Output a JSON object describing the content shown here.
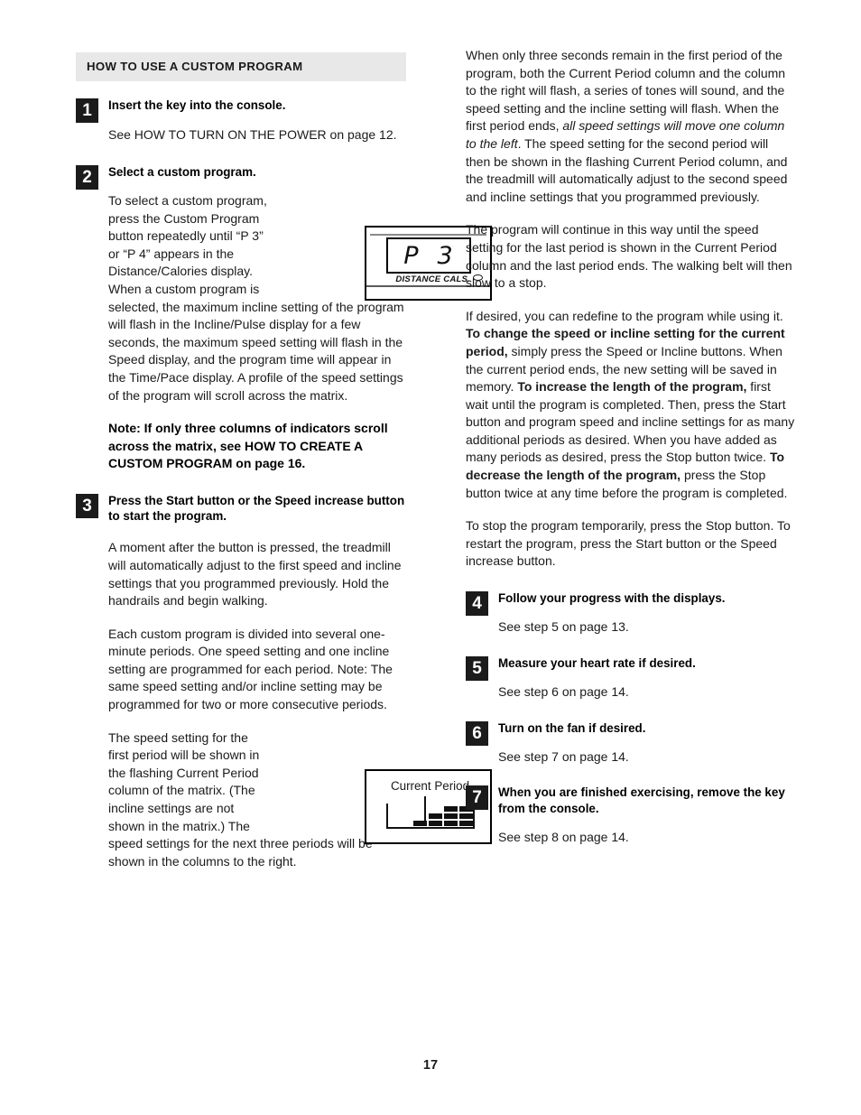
{
  "page": {
    "number": "17"
  },
  "left_column": {
    "section_heading": "HOW TO USE A CUSTOM PROGRAM",
    "steps": [
      {
        "number": "1",
        "title": "Insert the key into the console.",
        "body": "See HOW TO TURN ON THE POWER on page 12."
      },
      {
        "number": "2",
        "title": "Select a custom program.",
        "body_wrapped": "To select a custom program, press the Custom Program button repeatedly until “P 3” or “P 4” appears in the Distance/Calories display. When a custom program is selected, the maximum incline setting of the program will flash in the Incline/Pulse display for a few seconds, the maximum speed setting will flash in the Speed display, and the program time will appear in the Time/Pace display. A profile of the speed settings of the program will scroll across the matrix.",
        "note": "Note: If only three columns of indicators scroll across the matrix, see HOW TO CREATE A CUSTOM PROGRAM on page 16."
      },
      {
        "number": "3",
        "title": "Press the Start button or the Speed increase button to start the program.",
        "paragraph_1": "A moment after the button is pressed, the treadmill will automatically adjust to the first speed and incline settings that you programmed previously. Hold the handrails and begin walking.",
        "paragraph_2": "Each custom program is divided into several one-minute periods. One speed setting and one incline setting are programmed for each period. Note: The same speed setting and/or incline setting may be programmed for two or more consecutive periods.",
        "paragraph_3": "The speed setting for the first period will be shown in the flashing Current Period column of the matrix. (The incline settings are not shown in the matrix.) The speed settings for the next three periods will be shown in the columns to the right."
      }
    ]
  },
  "right_column": {
    "paragraphs": [
      {
        "id": "para-first-period",
        "segments": [
          {
            "text": "When only three seconds remain in the first period of the program, both the Current Period column and the column to the right will flash, a  series of tones will sound, and the speed setting and the incline setting will flash. When the first period ends, ",
            "style": "normal"
          },
          {
            "text": "all speed settings will move one column to the left",
            "style": "italic"
          },
          {
            "text": ". The speed setting for the second period will then be shown in the flashing Current Period column, and the treadmill will automatically adjust to the second speed and incline settings that you programmed previously.",
            "style": "normal"
          }
        ]
      },
      {
        "id": "para-continue",
        "segments": [
          {
            "text": "The program will continue in this way until the speed setting for the last period is shown in the Current Period column and the last period ends. The walking belt will then slow to a stop.",
            "style": "normal"
          }
        ]
      },
      {
        "id": "para-redefine",
        "segments": [
          {
            "text": "If desired, you can redefine to the program while using it. ",
            "style": "normal"
          },
          {
            "text": "To change the speed or incline setting for the current period,",
            "style": "bold"
          },
          {
            "text": " simply press the Speed or Incline buttons. When the current period ends, the new setting will be saved in memory. ",
            "style": "normal"
          },
          {
            "text": "To increase the length of the program,",
            "style": "bold"
          },
          {
            "text": " first wait until the program is completed. Then, press the Start button and program speed and incline settings for as many additional periods as desired. When you have added as many periods as desired, press the Stop button twice. ",
            "style": "normal"
          },
          {
            "text": "To decrease the length of the program,",
            "style": "bold"
          },
          {
            "text": " press the Stop button twice at any time before the program is completed.",
            "style": "normal"
          }
        ]
      },
      {
        "id": "para-stop-temporarily",
        "segments": [
          {
            "text": "To stop the program temporarily, press the Stop button. To restart the program, press the Start button or the Speed increase button.",
            "style": "normal"
          }
        ]
      }
    ],
    "steps": [
      {
        "number": "4",
        "title": "Follow your progress with the displays.",
        "body": "See step 5 on page 13."
      },
      {
        "number": "5",
        "title": "Measure your heart rate if desired.",
        "body": "See step 6 on page 14."
      },
      {
        "number": "6",
        "title": "Turn on the fan if desired.",
        "body": "See step 7 on page 14."
      },
      {
        "number": "7",
        "title": "When you are finished exercising, remove the key from the console.",
        "body": "See step 8 on page 14."
      }
    ]
  },
  "figures": {
    "lcd_display": {
      "digit_left": "P",
      "digit_right": "3",
      "label": "DISTANCE CALS.",
      "indicator": "oval-indicator"
    },
    "matrix_display": {
      "caption": "Current Period",
      "columns": [
        1,
        2,
        3,
        3
      ]
    }
  },
  "colors": {
    "section_bar_bg": "#e8e8e8",
    "step_badge_bg": "#1b1b1b",
    "text": "#1a1a1a"
  }
}
